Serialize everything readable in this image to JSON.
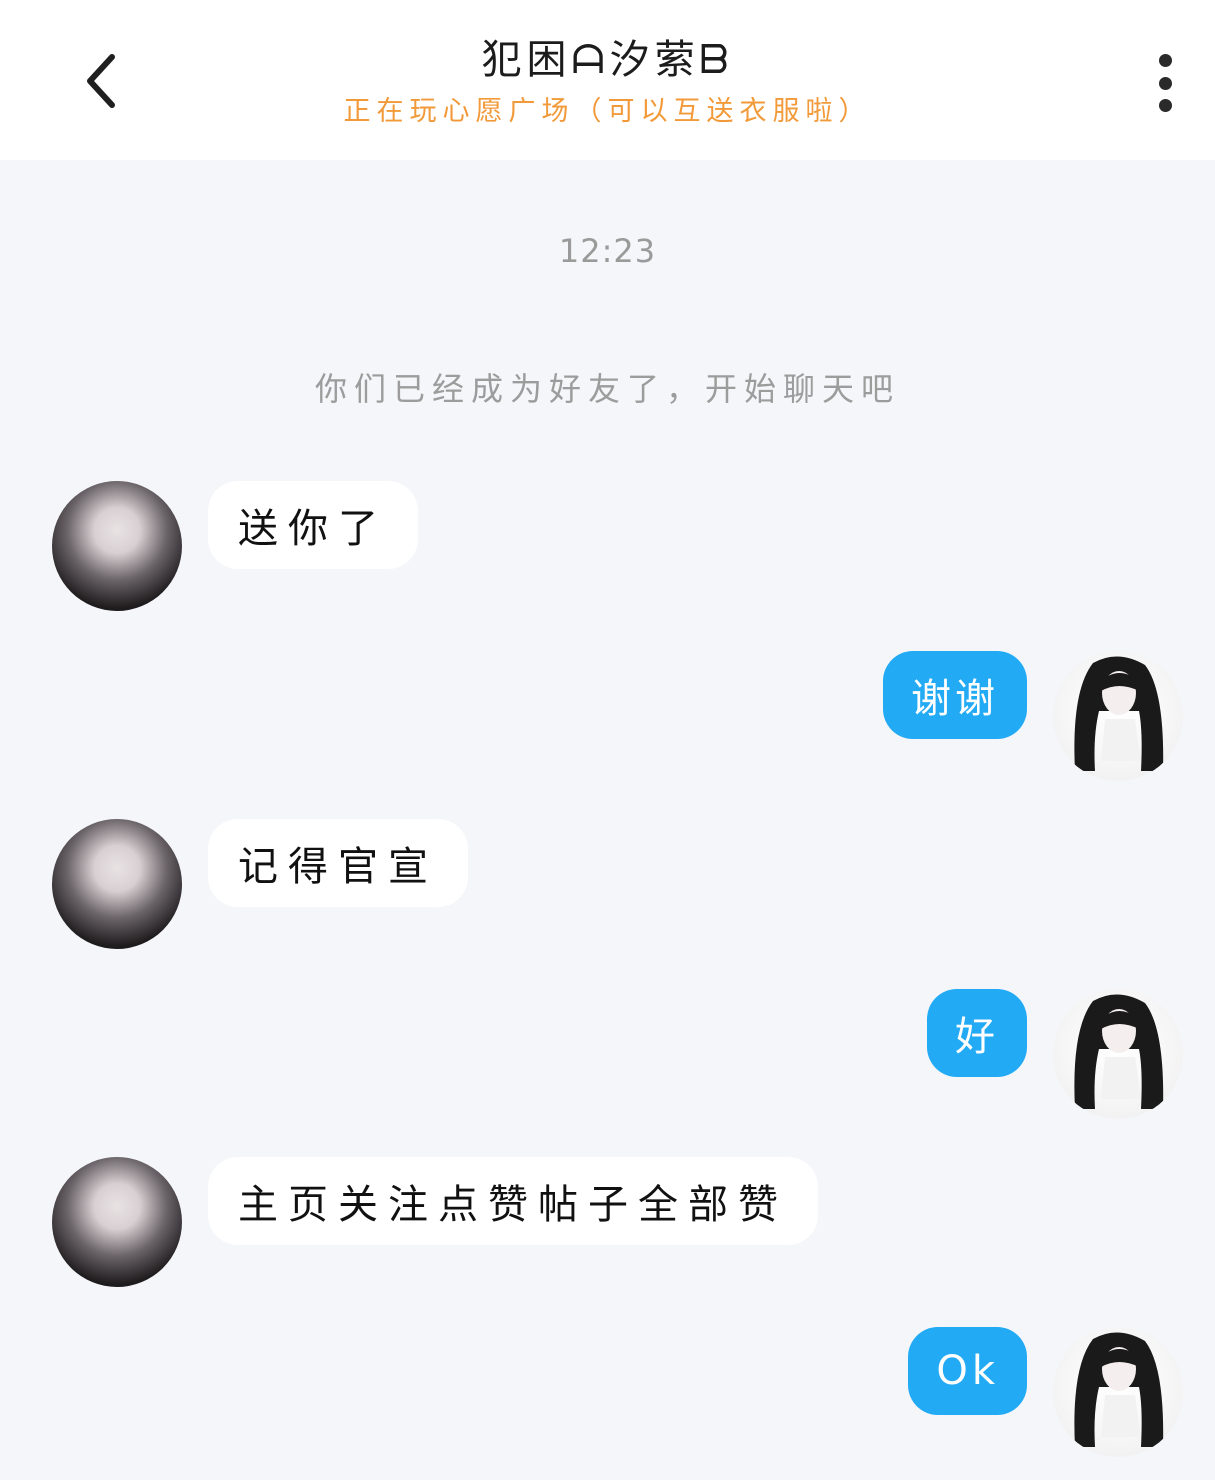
{
  "header": {
    "back_icon": "chevron-left-icon",
    "title": "犯困ᗩ汐萦ᗷ",
    "subtitle": "正在玩心愿广场（可以互送衣服啦）",
    "more_icon": "more-vertical-icon"
  },
  "chat": {
    "timestamp": "12:23",
    "system_message": "你们已经成为好友了，开始聊天吧",
    "messages": [
      {
        "sender": "friend",
        "text": "送你了"
      },
      {
        "sender": "me",
        "text": "谢谢"
      },
      {
        "sender": "friend",
        "text": "记得官宣"
      },
      {
        "sender": "me",
        "text": "好"
      },
      {
        "sender": "friend",
        "text": "主页关注点赞帖子全部赞"
      },
      {
        "sender": "me",
        "text": "Ok"
      }
    ]
  },
  "colors": {
    "background": "#f4f6f9",
    "header_background": "#ffffff",
    "subtitle": "#f29a3a",
    "outgoing_bubble": "#22aaf5",
    "incoming_bubble": "#ffffff",
    "meta_text": "#9a9a9a"
  }
}
